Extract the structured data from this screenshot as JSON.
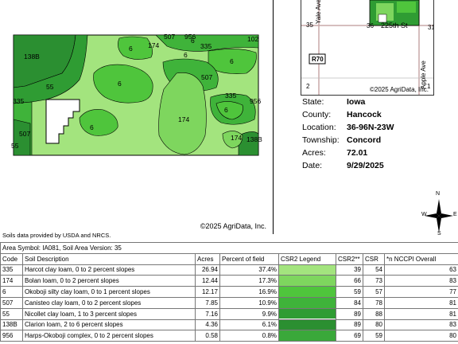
{
  "map": {
    "copyright": "©2025 AgriData, Inc.",
    "labels": {
      "l138B_a": "138B",
      "l55_a": "55",
      "l335_a": "335",
      "l507_a": "507",
      "l55_b": "55",
      "l174_a": "174",
      "l6_a": "6",
      "l507_b": "507",
      "l956_a": "956",
      "l335_b": "335",
      "l6_b": "6",
      "l102": "102",
      "l6_c": "6",
      "l6_d": "6",
      "l507_c": "507",
      "l6_e": "6",
      "l174_b": "174",
      "l6_f": "6",
      "l335_c": "335",
      "l956_b": "956",
      "l6_g": "6",
      "l174_c": "174",
      "l138B_b": "138B"
    }
  },
  "inset": {
    "road_yale": "Yale Ave",
    "road_225th": "225th St",
    "road_apple": "Apple Ave",
    "sec_35": "35",
    "sec_36": "36",
    "sec_31": "31",
    "sec_2": "2",
    "sec_1": "1",
    "route": "R70",
    "copyright": "©2025 AgriData, Inc."
  },
  "info": {
    "state_label": "State:",
    "state": "Iowa",
    "county_label": "County:",
    "county": "Hancock",
    "location_label": "Location:",
    "location": "36-96N-23W",
    "township_label": "Township:",
    "township": "Concord",
    "acres_label": "Acres:",
    "acres": "72.01",
    "date_label": "Date:",
    "date": "9/29/2025"
  },
  "compass": {
    "n": "N",
    "s": "S",
    "e": "E",
    "w": "W"
  },
  "sources": "Soils data provided by USDA and NRCS.",
  "table": {
    "area_symbol": "Area Symbol: IA081, Soil Area Version: 35",
    "headers": {
      "code": "Code",
      "desc": "Soil Description",
      "acres": "Acres",
      "pct": "Percent of field",
      "legend": "CSR2 Legend",
      "csr2": "CSR2**",
      "csr": "CSR",
      "nccpi": "*n NCCPI Overall"
    },
    "rows": [
      {
        "code": "335",
        "desc": "Harcot clay loam, 0 to 2 percent slopes",
        "acres": "26.94",
        "pct": "37.4%",
        "csr2": "39",
        "csr": "54",
        "nccpi": "63",
        "color": "#a3e47e"
      },
      {
        "code": "174",
        "desc": "Bolan loam, 0 to 2 percent slopes",
        "acres": "12.44",
        "pct": "17.3%",
        "csr2": "66",
        "csr": "73",
        "nccpi": "83",
        "color": "#7ed65e"
      },
      {
        "code": "6",
        "desc": "Okoboji silty clay loam, 0 to 1 percent slopes",
        "acres": "12.17",
        "pct": "16.9%",
        "csr2": "59",
        "csr": "57",
        "nccpi": "77",
        "color": "#4fc53c"
      },
      {
        "code": "507",
        "desc": "Canisteo clay loam, 0 to 2 percent slopes",
        "acres": "7.85",
        "pct": "10.9%",
        "csr2": "84",
        "csr": "78",
        "nccpi": "81",
        "color": "#3fb33a"
      },
      {
        "code": "55",
        "desc": "Nicollet clay loam, 1 to 3 percent slopes",
        "acres": "7.16",
        "pct": "9.9%",
        "csr2": "89",
        "csr": "88",
        "nccpi": "81",
        "color": "#2f9c33"
      },
      {
        "code": "138B",
        "desc": "Clarion loam, 2 to 6 percent slopes",
        "acres": "4.36",
        "pct": "6.1%",
        "csr2": "89",
        "csr": "80",
        "nccpi": "83",
        "color": "#2b8f31"
      },
      {
        "code": "956",
        "desc": "Harps-Okoboji complex, 0 to 2 percent slopes",
        "acres": "0.58",
        "pct": "0.8%",
        "csr2": "69",
        "csr": "59",
        "nccpi": "80",
        "color": "#3aa83a"
      }
    ]
  }
}
